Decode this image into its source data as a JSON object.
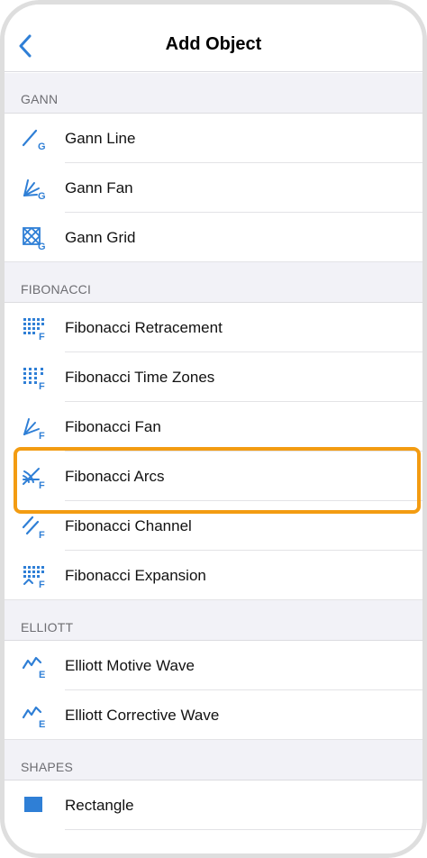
{
  "header": {
    "title": "Add Object"
  },
  "sections": [
    {
      "title": "GANN",
      "items": [
        {
          "label": "Gann Line",
          "icon": "gann-line-icon"
        },
        {
          "label": "Gann Fan",
          "icon": "gann-fan-icon"
        },
        {
          "label": "Gann Grid",
          "icon": "gann-grid-icon"
        }
      ]
    },
    {
      "title": "FIBONACCI",
      "items": [
        {
          "label": "Fibonacci Retracement",
          "icon": "fibonacci-retracement-icon"
        },
        {
          "label": "Fibonacci Time Zones",
          "icon": "fibonacci-time-zones-icon"
        },
        {
          "label": "Fibonacci Fan",
          "icon": "fibonacci-fan-icon"
        },
        {
          "label": "Fibonacci Arcs",
          "icon": "fibonacci-arcs-icon"
        },
        {
          "label": "Fibonacci Channel",
          "icon": "fibonacci-channel-icon"
        },
        {
          "label": "Fibonacci Expansion",
          "icon": "fibonacci-expansion-icon"
        }
      ]
    },
    {
      "title": "ELLIOTT",
      "items": [
        {
          "label": "Elliott Motive Wave",
          "icon": "elliott-motive-wave-icon"
        },
        {
          "label": "Elliott Corrective Wave",
          "icon": "elliott-corrective-wave-icon"
        }
      ]
    },
    {
      "title": "SHAPES",
      "items": [
        {
          "label": "Rectangle",
          "icon": "rectangle-icon"
        }
      ]
    }
  ],
  "colors": {
    "accent": "#2f7fd6",
    "highlight": "#f39c12",
    "section_bg": "#f2f2f7"
  }
}
